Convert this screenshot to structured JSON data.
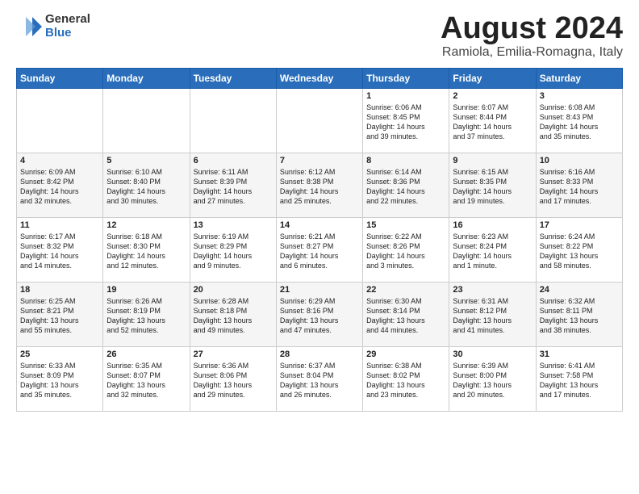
{
  "logo": {
    "general": "General",
    "blue": "Blue"
  },
  "title": "August 2024",
  "location": "Ramiola, Emilia-Romagna, Italy",
  "days_header": [
    "Sunday",
    "Monday",
    "Tuesday",
    "Wednesday",
    "Thursday",
    "Friday",
    "Saturday"
  ],
  "weeks": [
    [
      {
        "day": "",
        "info": ""
      },
      {
        "day": "",
        "info": ""
      },
      {
        "day": "",
        "info": ""
      },
      {
        "day": "",
        "info": ""
      },
      {
        "day": "1",
        "info": "Sunrise: 6:06 AM\nSunset: 8:45 PM\nDaylight: 14 hours\nand 39 minutes."
      },
      {
        "day": "2",
        "info": "Sunrise: 6:07 AM\nSunset: 8:44 PM\nDaylight: 14 hours\nand 37 minutes."
      },
      {
        "day": "3",
        "info": "Sunrise: 6:08 AM\nSunset: 8:43 PM\nDaylight: 14 hours\nand 35 minutes."
      }
    ],
    [
      {
        "day": "4",
        "info": "Sunrise: 6:09 AM\nSunset: 8:42 PM\nDaylight: 14 hours\nand 32 minutes."
      },
      {
        "day": "5",
        "info": "Sunrise: 6:10 AM\nSunset: 8:40 PM\nDaylight: 14 hours\nand 30 minutes."
      },
      {
        "day": "6",
        "info": "Sunrise: 6:11 AM\nSunset: 8:39 PM\nDaylight: 14 hours\nand 27 minutes."
      },
      {
        "day": "7",
        "info": "Sunrise: 6:12 AM\nSunset: 8:38 PM\nDaylight: 14 hours\nand 25 minutes."
      },
      {
        "day": "8",
        "info": "Sunrise: 6:14 AM\nSunset: 8:36 PM\nDaylight: 14 hours\nand 22 minutes."
      },
      {
        "day": "9",
        "info": "Sunrise: 6:15 AM\nSunset: 8:35 PM\nDaylight: 14 hours\nand 19 minutes."
      },
      {
        "day": "10",
        "info": "Sunrise: 6:16 AM\nSunset: 8:33 PM\nDaylight: 14 hours\nand 17 minutes."
      }
    ],
    [
      {
        "day": "11",
        "info": "Sunrise: 6:17 AM\nSunset: 8:32 PM\nDaylight: 14 hours\nand 14 minutes."
      },
      {
        "day": "12",
        "info": "Sunrise: 6:18 AM\nSunset: 8:30 PM\nDaylight: 14 hours\nand 12 minutes."
      },
      {
        "day": "13",
        "info": "Sunrise: 6:19 AM\nSunset: 8:29 PM\nDaylight: 14 hours\nand 9 minutes."
      },
      {
        "day": "14",
        "info": "Sunrise: 6:21 AM\nSunset: 8:27 PM\nDaylight: 14 hours\nand 6 minutes."
      },
      {
        "day": "15",
        "info": "Sunrise: 6:22 AM\nSunset: 8:26 PM\nDaylight: 14 hours\nand 3 minutes."
      },
      {
        "day": "16",
        "info": "Sunrise: 6:23 AM\nSunset: 8:24 PM\nDaylight: 14 hours\nand 1 minute."
      },
      {
        "day": "17",
        "info": "Sunrise: 6:24 AM\nSunset: 8:22 PM\nDaylight: 13 hours\nand 58 minutes."
      }
    ],
    [
      {
        "day": "18",
        "info": "Sunrise: 6:25 AM\nSunset: 8:21 PM\nDaylight: 13 hours\nand 55 minutes."
      },
      {
        "day": "19",
        "info": "Sunrise: 6:26 AM\nSunset: 8:19 PM\nDaylight: 13 hours\nand 52 minutes."
      },
      {
        "day": "20",
        "info": "Sunrise: 6:28 AM\nSunset: 8:18 PM\nDaylight: 13 hours\nand 49 minutes."
      },
      {
        "day": "21",
        "info": "Sunrise: 6:29 AM\nSunset: 8:16 PM\nDaylight: 13 hours\nand 47 minutes."
      },
      {
        "day": "22",
        "info": "Sunrise: 6:30 AM\nSunset: 8:14 PM\nDaylight: 13 hours\nand 44 minutes."
      },
      {
        "day": "23",
        "info": "Sunrise: 6:31 AM\nSunset: 8:12 PM\nDaylight: 13 hours\nand 41 minutes."
      },
      {
        "day": "24",
        "info": "Sunrise: 6:32 AM\nSunset: 8:11 PM\nDaylight: 13 hours\nand 38 minutes."
      }
    ],
    [
      {
        "day": "25",
        "info": "Sunrise: 6:33 AM\nSunset: 8:09 PM\nDaylight: 13 hours\nand 35 minutes."
      },
      {
        "day": "26",
        "info": "Sunrise: 6:35 AM\nSunset: 8:07 PM\nDaylight: 13 hours\nand 32 minutes."
      },
      {
        "day": "27",
        "info": "Sunrise: 6:36 AM\nSunset: 8:06 PM\nDaylight: 13 hours\nand 29 minutes."
      },
      {
        "day": "28",
        "info": "Sunrise: 6:37 AM\nSunset: 8:04 PM\nDaylight: 13 hours\nand 26 minutes."
      },
      {
        "day": "29",
        "info": "Sunrise: 6:38 AM\nSunset: 8:02 PM\nDaylight: 13 hours\nand 23 minutes."
      },
      {
        "day": "30",
        "info": "Sunrise: 6:39 AM\nSunset: 8:00 PM\nDaylight: 13 hours\nand 20 minutes."
      },
      {
        "day": "31",
        "info": "Sunrise: 6:41 AM\nSunset: 7:58 PM\nDaylight: 13 hours\nand 17 minutes."
      }
    ]
  ]
}
